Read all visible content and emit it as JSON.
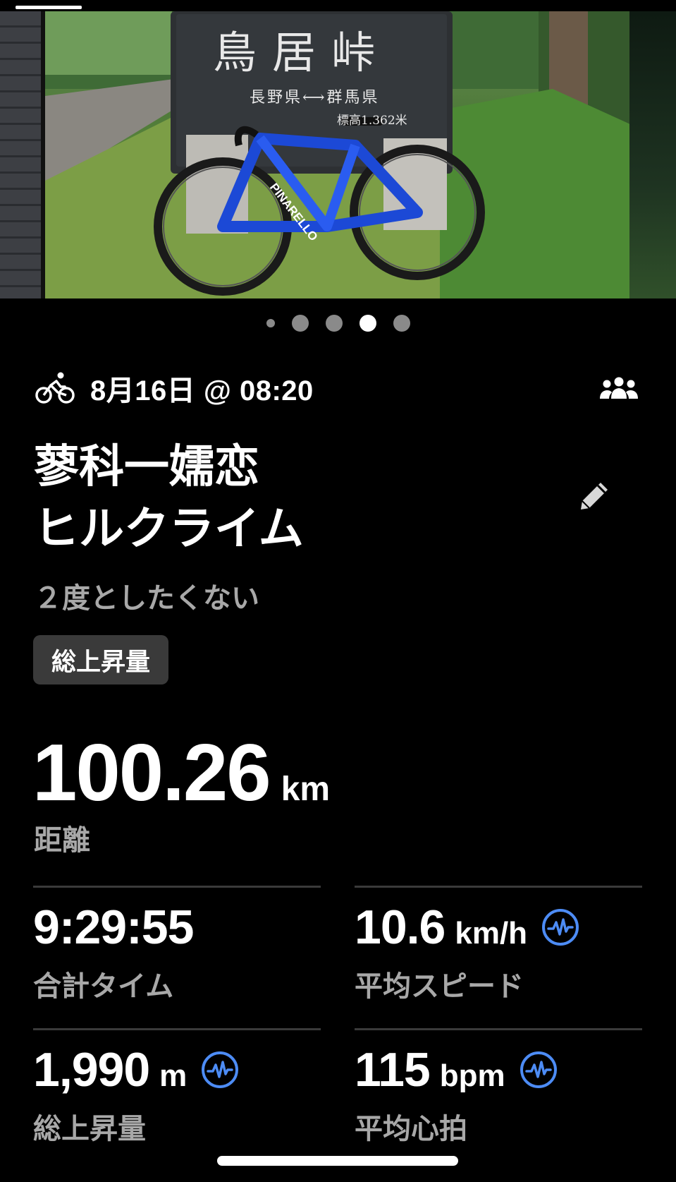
{
  "photo": {
    "sign_title": "鳥居峠",
    "sign_route": "長野県⟷群馬県",
    "sign_elevation": "標高1.362米",
    "frame_brand": "PINARELLO"
  },
  "pager": {
    "count": 5,
    "active_index": 3
  },
  "activity": {
    "sport_icon": "bike-icon",
    "datetime": "8月16日 @ 08:20",
    "group_icon": "group-icon",
    "title_line1": "蓼科一嬬恋",
    "title_line2": "ヒルクライム",
    "description": "２度としたくない",
    "tag": "総上昇量"
  },
  "hero": {
    "value": "100.26",
    "unit": "km",
    "label": "距離"
  },
  "stats": [
    {
      "value": "9:29:55",
      "unit": "",
      "label": "合計タイム",
      "has_pulse": false
    },
    {
      "value": "10.6",
      "unit": "km/h",
      "label": "平均スピード",
      "has_pulse": true
    },
    {
      "value": "1,990",
      "unit": "m",
      "label": "総上昇量",
      "has_pulse": true
    },
    {
      "value": "115",
      "unit": "bpm",
      "label": "平均心拍",
      "has_pulse": true
    }
  ],
  "colors": {
    "accent_blue": "#4d8cf5",
    "background": "#000000",
    "muted_text": "#a8a8a8",
    "tag_bg": "#3a3a3a"
  }
}
